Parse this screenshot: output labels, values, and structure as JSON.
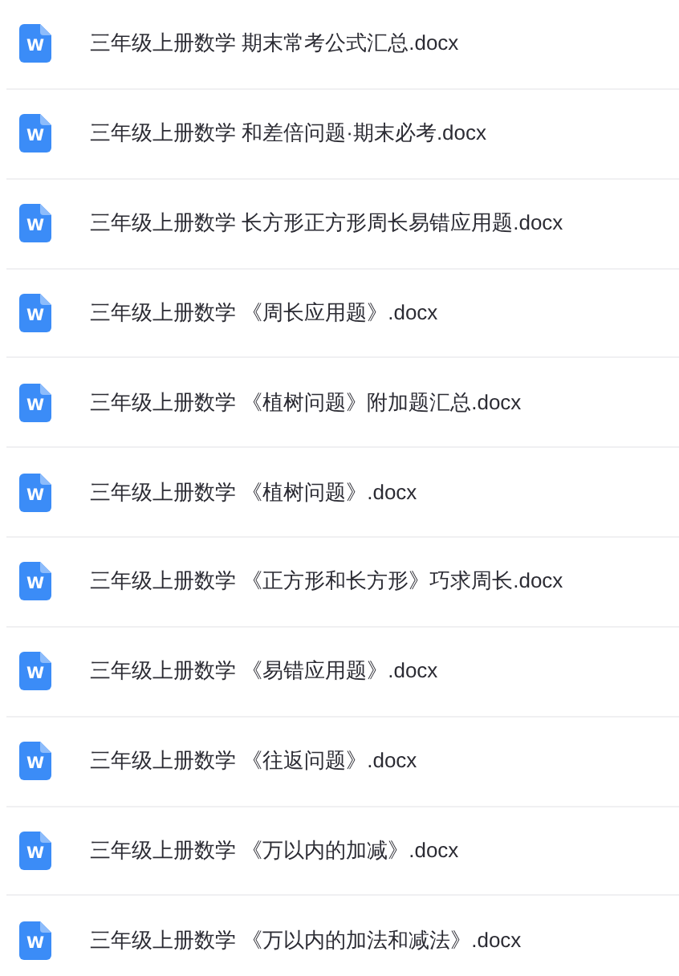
{
  "files": [
    {
      "icon": "W",
      "name": "三年级上册数学 期末常考公式汇总.docx"
    },
    {
      "icon": "W",
      "name": "三年级上册数学 和差倍问题·期末必考.docx"
    },
    {
      "icon": "W",
      "name": "三年级上册数学 长方形正方形周长易错应用题.docx"
    },
    {
      "icon": "W",
      "name": "三年级上册数学 《周长应用题》.docx"
    },
    {
      "icon": "W",
      "name": "三年级上册数学 《植树问题》附加题汇总.docx"
    },
    {
      "icon": "W",
      "name": "三年级上册数学 《植树问题》.docx"
    },
    {
      "icon": "W",
      "name": "三年级上册数学 《正方形和长方形》巧求周长.docx"
    },
    {
      "icon": "W",
      "name": "三年级上册数学 《易错应用题》.docx"
    },
    {
      "icon": "W",
      "name": "三年级上册数学 《往返问题》.docx"
    },
    {
      "icon": "W",
      "name": "三年级上册数学 《万以内的加减》.docx"
    },
    {
      "icon": "W",
      "name": "三年级上册数学 《万以内的加法和减法》.docx"
    }
  ]
}
